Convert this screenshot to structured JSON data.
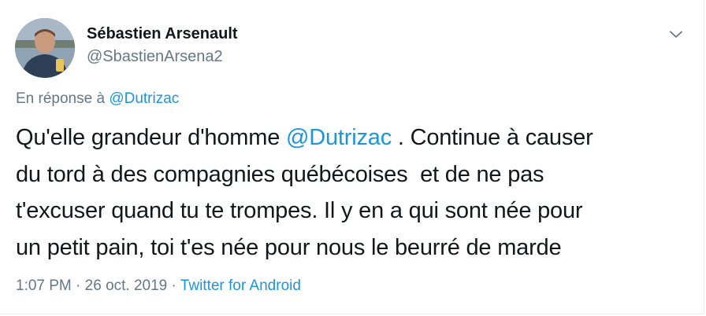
{
  "author": {
    "name": "Sébastien Arsenault",
    "handle": "@SbastienArsena2"
  },
  "icons": {
    "avatar": "profile-photo",
    "menu": "chevron-down-icon"
  },
  "reply": {
    "prefix": "En réponse à",
    "mention": "@Dutrizac"
  },
  "tweet": {
    "line1_before": "Qu'elle grandeur d'homme ",
    "line1_mention": "@Dutrizac",
    "line1_after": " . Continue à causer",
    "line2": "du tord à des compagnies québécoises  et de ne pas",
    "line3": "t'excuser quand tu te trompes. Il y en a qui sont née pour",
    "line4": "un petit pain, toi t'es née pour nous le beurré de marde"
  },
  "meta": {
    "time": "1:07 PM",
    "separator1": " · ",
    "date": "26 oct. 2019",
    "separator2": " · ",
    "source": "Twitter for Android"
  },
  "colors": {
    "text": "#14171a",
    "secondary": "#657786",
    "link": "#1b95e0",
    "border": "#e6ecf0"
  }
}
